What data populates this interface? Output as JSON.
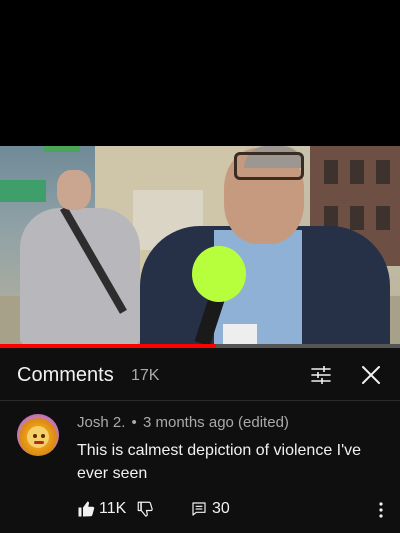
{
  "video": {
    "progress_fraction": 0.54,
    "progress_color": "#ff0000"
  },
  "comments_panel": {
    "title": "Comments",
    "count": "17K",
    "icons": {
      "filter": "sort-filter-icon",
      "close": "close-icon"
    }
  },
  "comment": {
    "author": "Josh 2.",
    "separator": "•",
    "time": "3 months ago (edited)",
    "text": "This is calmest depiction of violence I've ever seen",
    "likes": "11K",
    "replies": "30",
    "icons": {
      "like": "thumbs-up-icon",
      "dislike": "thumbs-down-icon",
      "reply": "reply-icon",
      "more": "more-vert-icon"
    }
  },
  "colors": {
    "panel_bg": "#0f0f0f",
    "text": "#f1f1f1",
    "secondary": "#aaaaaa"
  }
}
